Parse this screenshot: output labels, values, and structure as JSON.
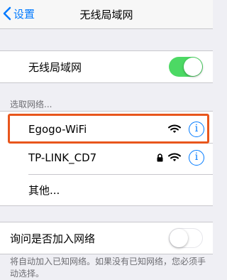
{
  "nav": {
    "back_label": "设置",
    "title": "无线局域网"
  },
  "wifi_toggle": {
    "label": "无线局域网",
    "on": true
  },
  "networks_header": "选取网络...",
  "networks": [
    {
      "name": "Egogo-WiFi",
      "locked": false,
      "icon": "wifi-icon",
      "info_glyph": "i"
    },
    {
      "name": "TP-LINK_CD7",
      "locked": true,
      "icon": "wifi-icon",
      "info_glyph": "i"
    }
  ],
  "other_label": "其他...",
  "ask_join": {
    "label": "询问是否加入网络",
    "on": false,
    "footer": "将自动加入已知网络。如果没有已知网络，您必须手动选择。"
  },
  "colors": {
    "accent": "#007aff",
    "toggle_on": "#4cd964",
    "highlight": "#e8561c"
  }
}
